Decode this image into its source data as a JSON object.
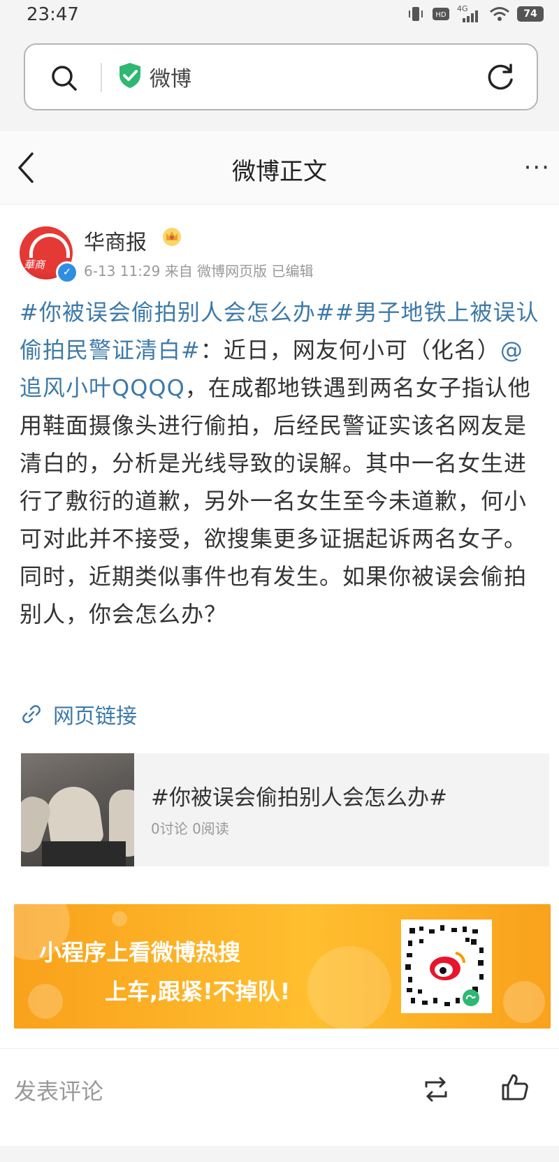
{
  "status_bar": {
    "time": "23:47",
    "network": "4G",
    "battery": "74"
  },
  "browser": {
    "url_label": "微博"
  },
  "nav": {
    "title": "微博正文",
    "more": "···"
  },
  "post": {
    "author": "华商报",
    "avatar_text": "華商",
    "meta": "6-13 11:29 来自 微博网页版 已编辑",
    "tag1": "#你被误会偷拍别人会怎么办#",
    "tag2": "#男子地铁上被误认偷拍民警证清白#",
    "text1": "：近日，网友何小可（化名）",
    "mention": "@追风小叶QQQQ",
    "text2": "，在成都地铁遇到两名女子指认他用鞋面摄像头进行偷拍，后经民警证实该名网友是清白的，分析是光线导致的误解。其中一名女生进行了敷衍的道歉，另外一名女生至今未道歉，何小可对此并不接受，欲搜集更多证据起诉两名女子。同时，近期类似事件也有发生。如果你被误会偷拍别人，你会怎么办？",
    "web_link": "网页链接"
  },
  "topic_card": {
    "title": "#你被误会偷拍别人会怎么办#",
    "stats": "0讨论 0阅读"
  },
  "banner": {
    "line1": "小程序上看微博热搜",
    "line2": "上车,跟紧!不掉队!"
  },
  "comment_bar": {
    "placeholder": "发表评论"
  },
  "colors": {
    "link": "#3d7aa8",
    "banner": "#f9a11b",
    "shield": "#2eb872"
  }
}
